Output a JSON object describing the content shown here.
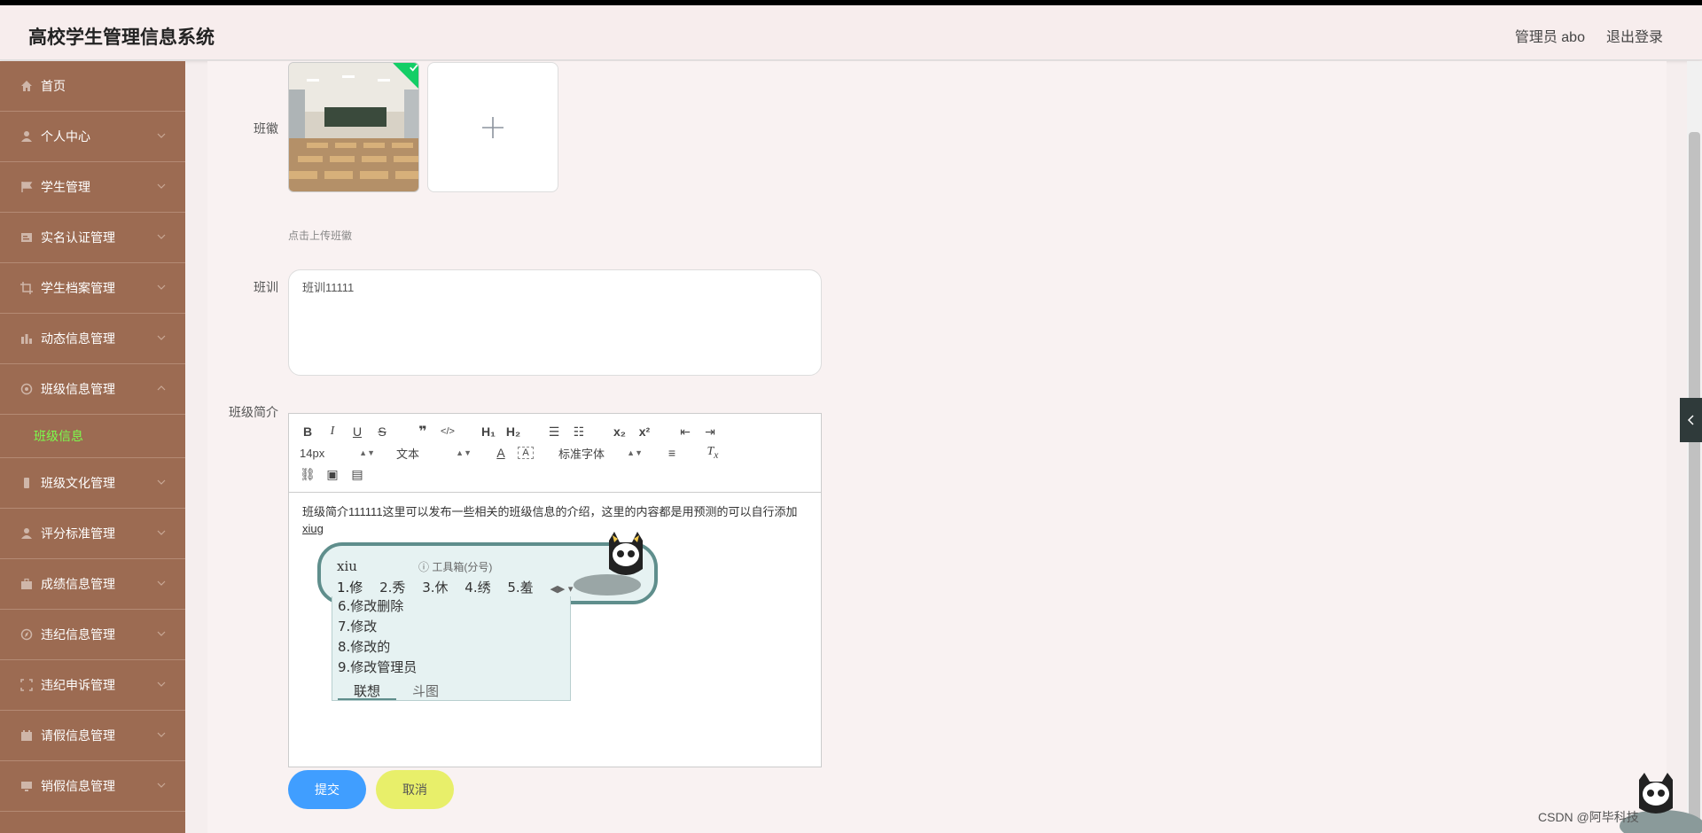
{
  "app": {
    "title": "高校学生管理信息系统"
  },
  "header": {
    "user": "管理员 abo",
    "logout": "退出登录"
  },
  "sidebar": {
    "items": [
      {
        "label": "首页",
        "icon": "home-icon"
      },
      {
        "label": "个人中心",
        "icon": "user-icon"
      },
      {
        "label": "学生管理",
        "icon": "flag-icon"
      },
      {
        "label": "实名认证管理",
        "icon": "id-card-icon"
      },
      {
        "label": "学生档案管理",
        "icon": "crop-icon"
      },
      {
        "label": "动态信息管理",
        "icon": "bar-chart-icon"
      },
      {
        "label": "班级信息管理",
        "icon": "circle-icon"
      },
      {
        "label": "班级文化管理",
        "icon": "mobile-icon"
      },
      {
        "label": "评分标准管理",
        "icon": "user-icon"
      },
      {
        "label": "成绩信息管理",
        "icon": "briefcase-icon"
      },
      {
        "label": "违纪信息管理",
        "icon": "compass-icon"
      },
      {
        "label": "违纪申诉管理",
        "icon": "frame-icon"
      },
      {
        "label": "请假信息管理",
        "icon": "calendar-icon"
      },
      {
        "label": "销假信息管理",
        "icon": "monitor-icon"
      }
    ],
    "active_sub": "班级信息"
  },
  "form": {
    "banhui_label": "班徽",
    "upload_hint": "点击上传班徽",
    "banxun_label": "班训",
    "banxun_value": "班训11111",
    "jianjie_label": "班级简介",
    "editor_text": "班级简介111111这里可以发布一些相关的班级信息的介绍，这里的内容都是用预测的可以自行添加",
    "editor_typing": "xiug",
    "submit": "提交",
    "cancel": "取消"
  },
  "editor_toolbar": {
    "size": "14px",
    "format": "文本",
    "font": "标准字体"
  },
  "ime": {
    "pinyin": "xiu",
    "tools": "工具箱(分号)",
    "candidates": [
      "1.修",
      "2.秀",
      "3.休",
      "4.绣",
      "5.羞"
    ],
    "more": [
      "6.修改删除",
      "7.修改",
      "8.修改的",
      "9.修改管理员"
    ],
    "tab_active": "联想",
    "tab_other": "斗图"
  },
  "watermark": "CSDN @阿毕科技",
  "colors": {
    "sidebar": "#9c6b52",
    "active_sub": "#7cfc4c",
    "submit": "#409eff",
    "cancel": "#e8ef6a"
  }
}
